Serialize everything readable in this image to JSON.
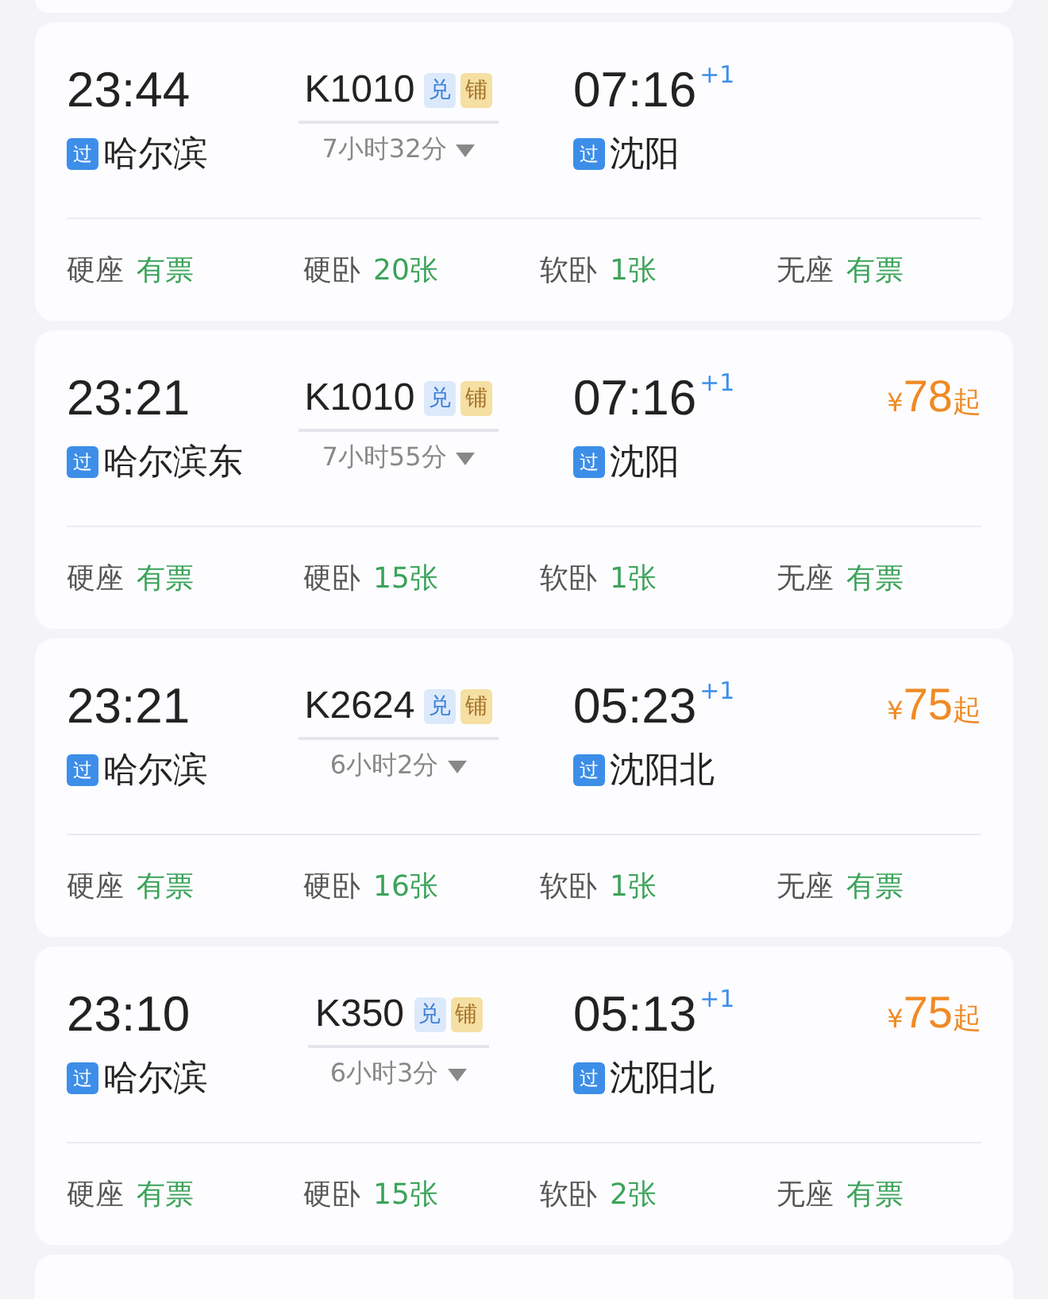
{
  "trains": [
    {
      "depart_time": "23:44",
      "depart_station": {
        "tag": "过",
        "name": "哈尔滨"
      },
      "number": "K1010",
      "badges": [
        {
          "kind": "exchange",
          "text": "兑"
        },
        {
          "kind": "berth",
          "text": "铺"
        }
      ],
      "duration": "7小时32分",
      "arrive_time": "07:16",
      "day_offset": "+1",
      "arrive_station": {
        "tag": "过",
        "name": "沈阳"
      },
      "seats": [
        {
          "type": "硬座",
          "status": "有票"
        },
        {
          "type": "硬卧",
          "status": "20张"
        },
        {
          "type": "软卧",
          "status": "1张"
        },
        {
          "type": "无座",
          "status": "有票"
        }
      ]
    },
    {
      "depart_time": "23:21",
      "depart_station": {
        "tag": "过",
        "name": "哈尔滨东"
      },
      "number": "K1010",
      "badges": [
        {
          "kind": "exchange",
          "text": "兑"
        },
        {
          "kind": "berth",
          "text": "铺"
        }
      ],
      "duration": "7小时55分",
      "arrive_time": "07:16",
      "day_offset": "+1",
      "arrive_station": {
        "tag": "过",
        "name": "沈阳"
      },
      "price": {
        "currency": "¥",
        "amount": "78",
        "suffix": "起"
      },
      "seats": [
        {
          "type": "硬座",
          "status": "有票"
        },
        {
          "type": "硬卧",
          "status": "15张"
        },
        {
          "type": "软卧",
          "status": "1张"
        },
        {
          "type": "无座",
          "status": "有票"
        }
      ]
    },
    {
      "depart_time": "23:21",
      "depart_station": {
        "tag": "过",
        "name": "哈尔滨"
      },
      "number": "K2624",
      "badges": [
        {
          "kind": "exchange",
          "text": "兑"
        },
        {
          "kind": "berth",
          "text": "铺"
        }
      ],
      "duration": "6小时2分",
      "arrive_time": "05:23",
      "day_offset": "+1",
      "arrive_station": {
        "tag": "过",
        "name": "沈阳北"
      },
      "price": {
        "currency": "¥",
        "amount": "75",
        "suffix": "起"
      },
      "seats": [
        {
          "type": "硬座",
          "status": "有票"
        },
        {
          "type": "硬卧",
          "status": "16张"
        },
        {
          "type": "软卧",
          "status": "1张"
        },
        {
          "type": "无座",
          "status": "有票"
        }
      ]
    },
    {
      "depart_time": "23:10",
      "depart_station": {
        "tag": "过",
        "name": "哈尔滨"
      },
      "number": "K350",
      "badges": [
        {
          "kind": "exchange",
          "text": "兑"
        },
        {
          "kind": "berth",
          "text": "铺"
        }
      ],
      "duration": "6小时3分",
      "arrive_time": "05:13",
      "day_offset": "+1",
      "arrive_station": {
        "tag": "过",
        "name": "沈阳北"
      },
      "price": {
        "currency": "¥",
        "amount": "75",
        "suffix": "起"
      },
      "seats": [
        {
          "type": "硬座",
          "status": "有票"
        },
        {
          "type": "硬卧",
          "status": "15张"
        },
        {
          "type": "软卧",
          "status": "2张"
        },
        {
          "type": "无座",
          "status": "有票"
        }
      ]
    }
  ]
}
